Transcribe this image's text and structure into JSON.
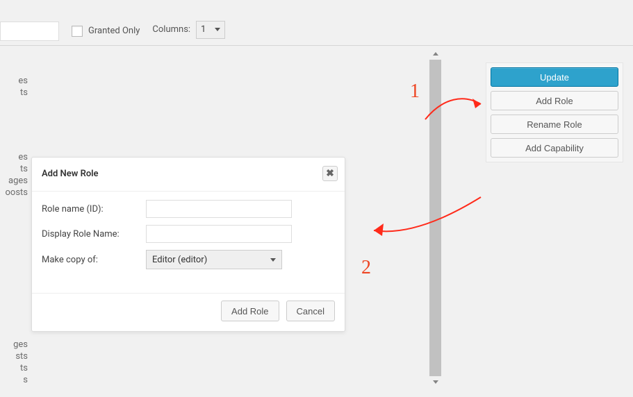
{
  "toolbar": {
    "filter_value": "",
    "granted_only_label": "Granted Only",
    "granted_only_checked": false,
    "columns_label": "Columns:",
    "columns_selected": "1"
  },
  "capabilities_left": {
    "block1": [
      "es",
      "ts"
    ],
    "block2": [
      "es",
      "ts",
      "ages",
      "oosts"
    ],
    "block3": [
      "ges",
      "sts",
      "ts",
      "s"
    ]
  },
  "sidebar": {
    "update_label": "Update",
    "add_role_label": "Add Role",
    "rename_role_label": "Rename Role",
    "add_capability_label": "Add Capability"
  },
  "dialog": {
    "title": "Add New Role",
    "close_symbol": "✖",
    "role_name_label": "Role name (ID):",
    "role_name_value": "",
    "display_name_label": "Display Role Name:",
    "display_name_value": "",
    "copy_of_label": "Make copy of:",
    "copy_of_selected": "Editor (editor)",
    "add_button": "Add Role",
    "cancel_button": "Cancel"
  },
  "annotations": {
    "num1": "1",
    "num2": "2"
  }
}
